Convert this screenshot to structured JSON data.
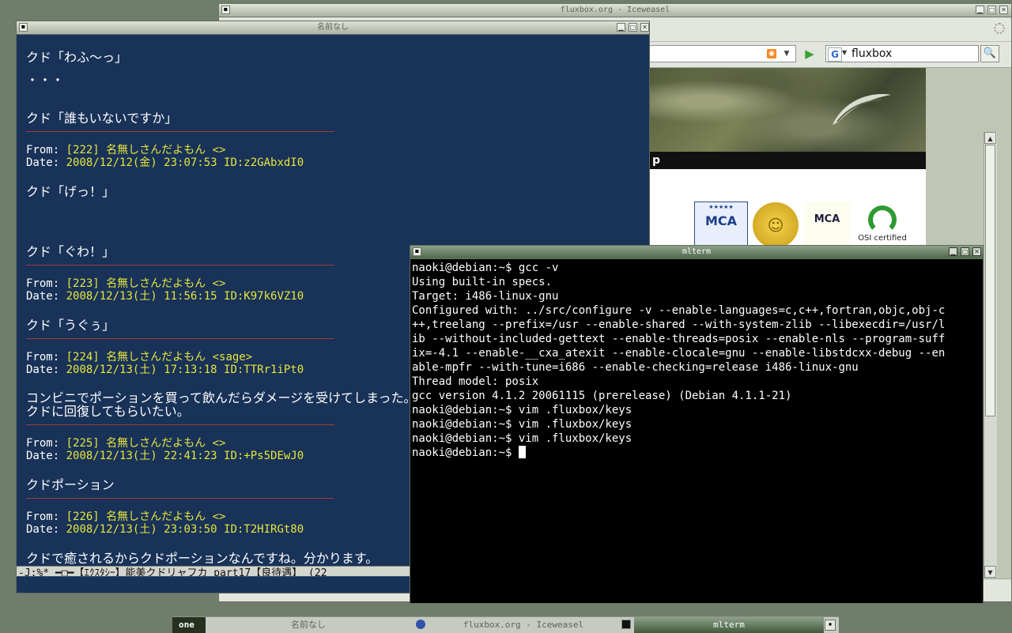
{
  "browser": {
    "title": "fluxbox.org - Iceweasel",
    "search_engine_icon": "G",
    "search_value": "fluxbox",
    "dark_bar_text": "p",
    "badges": {
      "mca1": "MCA",
      "mca2": "MCA",
      "osi": "OSI certified"
    }
  },
  "viewer": {
    "title": "名前なし",
    "lines": [
      {
        "text": "クド「わふ〜っ」"
      },
      {
        "text": "・・・"
      },
      {
        "text": "クド「誰もいないですか」"
      }
    ],
    "posts": [
      {
        "from_label": "From:",
        "from_value": "[222] 名無しさんだよもん <>",
        "date_label": "Date:",
        "date_value": "2008/12/12(金) 23:07:53 ID:z2GAbxdI0",
        "body": [
          "クド「げっ！」",
          "",
          "",
          "クド「ぐわ！」"
        ]
      },
      {
        "from_label": "From:",
        "from_value": "[223] 名無しさんだよもん <>",
        "date_label": "Date:",
        "date_value": "2008/12/13(土) 11:56:15 ID:K97k6VZ10",
        "body": [
          "クド「うぐぅ」"
        ]
      },
      {
        "from_label": "From:",
        "from_value": "[224] 名無しさんだよもん <sage>",
        "date_label": "Date:",
        "date_value": "2008/12/13(土) 17:13:18 ID:TTRr1iPt0",
        "body": [
          "コンビニでポーションを買って飲んだらダメージを受けてしまった。c",
          "クドに回復してもらいたい。"
        ]
      },
      {
        "from_label": "From:",
        "from_value": "[225] 名無しさんだよもん <>",
        "date_label": "Date:",
        "date_value": "2008/12/13(土) 22:41:23 ID:+Ps5DEwJ0",
        "body": [
          "クドポーション"
        ]
      },
      {
        "from_label": "From:",
        "from_value": "[226] 名無しさんだよもん <>",
        "date_label": "Date:",
        "date_value": "2008/12/13(土) 23:03:50 ID:T2HIRGt80",
        "body": [
          "クドで癒されるからクドポーションなんですね。分かります。"
        ]
      }
    ],
    "modeline": "-J:%*   ━□━【ｴｸｽﾀｼｰ】能美クドリャフカ part17【良待遇】 (22"
  },
  "terminal": {
    "title": "mlterm",
    "lines": [
      "naoki@debian:~$ gcc -v",
      "Using built-in specs.",
      "Target: i486-linux-gnu",
      "Configured with: ../src/configure -v --enable-languages=c,c++,fortran,objc,obj-c",
      "++,treelang --prefix=/usr --enable-shared --with-system-zlib --libexecdir=/usr/l",
      "ib --without-included-gettext --enable-threads=posix --enable-nls --program-suff",
      "ix=-4.1 --enable-__cxa_atexit --enable-clocale=gnu --enable-libstdcxx-debug --en",
      "able-mpfr --with-tune=i686 --enable-checking=release i486-linux-gnu",
      "Thread model: posix",
      "gcc version 4.1.2 20061115 (prerelease) (Debian 4.1.1-21)",
      "naoki@debian:~$ vim .fluxbox/keys",
      "naoki@debian:~$ vim .fluxbox/keys",
      "naoki@debian:~$ vim .fluxbox/keys"
    ],
    "prompt": "naoki@debian:~$ "
  },
  "taskbar": {
    "workspace": "one",
    "tasks": [
      "名前なし",
      "fluxbox.org - Iceweasel",
      "mlterm"
    ],
    "active_task": "mlterm"
  },
  "icons": {
    "menu": "window-menu-icon",
    "minimize": "minimize-icon",
    "maximize": "maximize-icon",
    "close": "close-icon",
    "rss": "rss-icon",
    "go": "go-arrow-icon",
    "search": "search-icon",
    "throbber": "throbber-icon"
  }
}
